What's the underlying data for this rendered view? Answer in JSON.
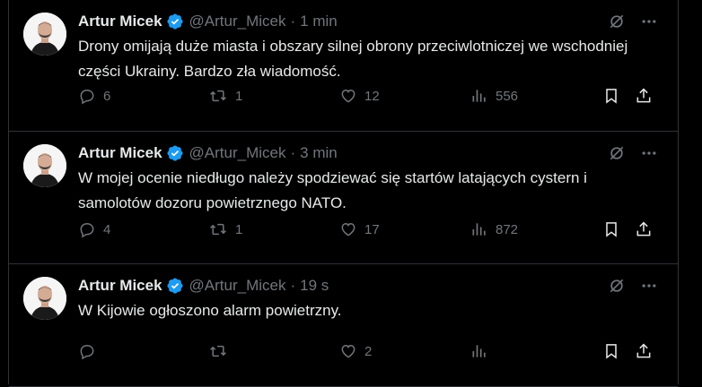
{
  "tweets": [
    {
      "name": "Artur Micek",
      "handle": "@Artur_Micek",
      "time": "1 min",
      "text": "Drony omijają duże miasta i obszary silnej obrony przeciwlotniczej we wschodniej części Ukrainy. Bardzo zła wiadomość.",
      "replies": "6",
      "retweets": "1",
      "likes": "12",
      "views": "556"
    },
    {
      "name": "Artur Micek",
      "handle": "@Artur_Micek",
      "time": "3 min",
      "text": "W mojej ocenie niedługo należy spodziewać się startów latających cystern i samolotów dozoru powietrznego NATO.",
      "replies": "4",
      "retweets": "1",
      "likes": "17",
      "views": "872"
    },
    {
      "name": "Artur Micek",
      "handle": "@Artur_Micek",
      "time": "19 s",
      "text": "W Kijowie ogłoszono alarm powietrzny.",
      "replies": "",
      "retweets": "",
      "likes": "2",
      "views": ""
    }
  ],
  "separator": "·",
  "icons": {
    "verified": "verified-badge-icon",
    "grok": "grok-icon",
    "more": "more-icon",
    "reply": "reply-icon",
    "retweet": "retweet-icon",
    "like": "like-icon",
    "views": "views-icon",
    "bookmark": "bookmark-icon",
    "share": "share-icon"
  },
  "colors": {
    "background": "#000000",
    "text": "#e7e9ea",
    "muted": "#71767b",
    "verified": "#1d9bf0",
    "divider": "#2f3336"
  }
}
